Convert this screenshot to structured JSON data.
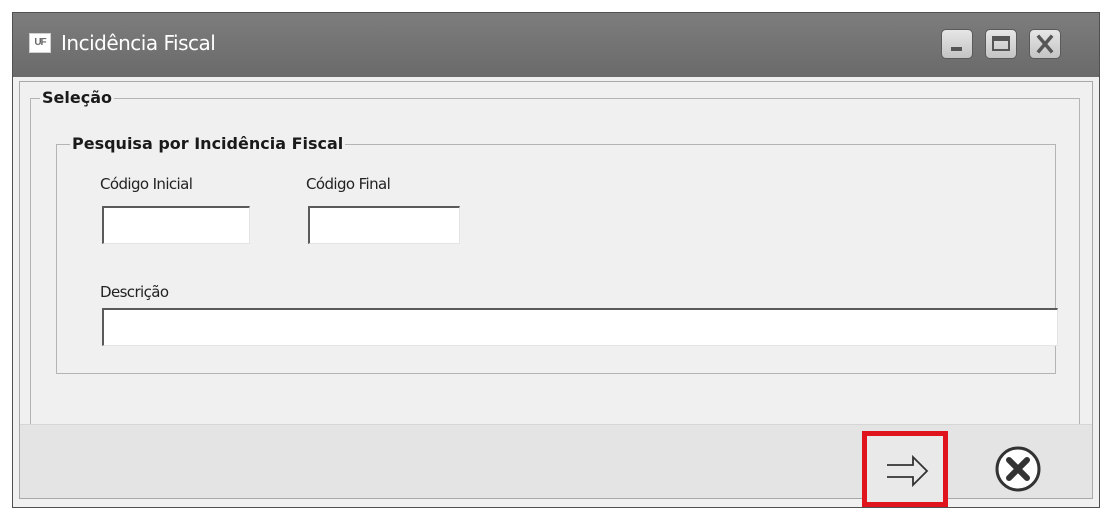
{
  "window": {
    "title": "Incidência Fiscal",
    "app_icon_text": "UF",
    "controls": {
      "minimize": "minimize-icon",
      "maximize": "maximize-icon",
      "close": "close-icon"
    }
  },
  "selection_group": {
    "legend": "Seleção",
    "search_group": {
      "legend": "Pesquisa por Incidência Fiscal",
      "codigo_inicial": {
        "label": "Código Inicial",
        "value": ""
      },
      "codigo_final": {
        "label": "Código Final",
        "value": ""
      },
      "descricao": {
        "label": "Descrição",
        "value": ""
      }
    }
  },
  "actions": {
    "execute_icon": "arrow-right-icon",
    "cancel_icon": "cancel-x-icon",
    "highlight_color": "#e0141c"
  }
}
